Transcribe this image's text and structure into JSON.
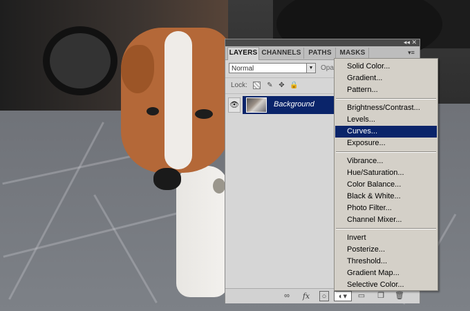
{
  "panel": {
    "tabs": [
      {
        "label": "LAYERS"
      },
      {
        "label": "CHANNELS"
      },
      {
        "label": "PATHS"
      },
      {
        "label": "MASKS"
      }
    ],
    "blend_mode": "Normal",
    "opacity_label": "Opa",
    "lock_label": "Lock:",
    "layer": {
      "name": "Background"
    }
  },
  "menu": {
    "items": [
      {
        "label": "Solid Color..."
      },
      {
        "label": "Gradient..."
      },
      {
        "label": "Pattern..."
      },
      {
        "label": "Brightness/Contrast..."
      },
      {
        "label": "Levels..."
      },
      {
        "label": "Curves...",
        "highlighted": true
      },
      {
        "label": "Exposure..."
      },
      {
        "label": "Vibrance..."
      },
      {
        "label": "Hue/Saturation..."
      },
      {
        "label": "Color Balance..."
      },
      {
        "label": "Black & White..."
      },
      {
        "label": "Photo Filter..."
      },
      {
        "label": "Channel Mixer..."
      },
      {
        "label": "Invert"
      },
      {
        "label": "Posterize..."
      },
      {
        "label": "Threshold..."
      },
      {
        "label": "Gradient Map..."
      },
      {
        "label": "Selective Color..."
      }
    ]
  },
  "colors": {
    "selection": "#0a246a",
    "menu_bg": "#d4d0c8",
    "panel_bg": "#d6d6d6"
  }
}
